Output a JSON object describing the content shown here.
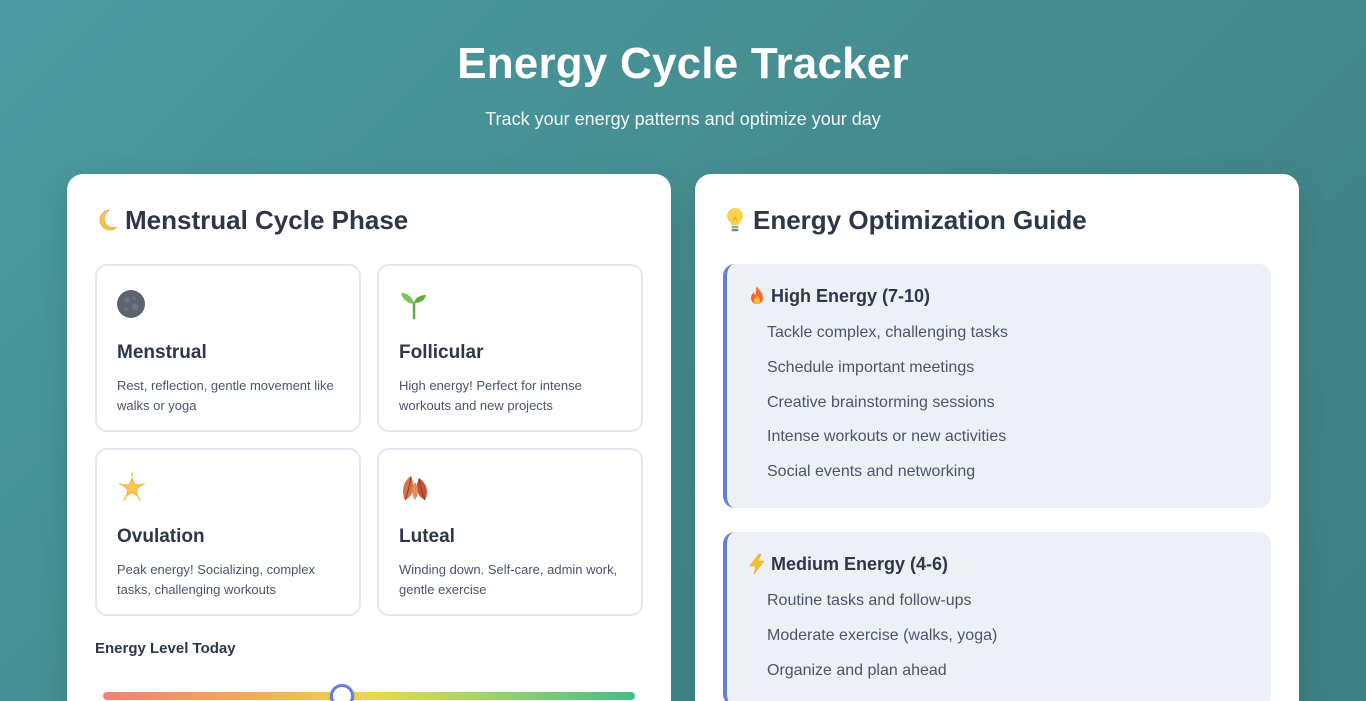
{
  "header": {
    "title": "Energy Cycle Tracker",
    "subtitle": "Track your energy patterns and optimize your day"
  },
  "cycle": {
    "title": "Menstrual Cycle Phase",
    "title_icon": "crescent-moon-icon",
    "phases": [
      {
        "name": "Menstrual",
        "icon": "new-moon-icon",
        "description": "Rest, reflection, gentle movement like walks or yoga"
      },
      {
        "name": "Follicular",
        "icon": "seedling-icon",
        "description": "High energy! Perfect for intense workouts and new projects"
      },
      {
        "name": "Ovulation",
        "icon": "glowing-star-icon",
        "description": "Peak energy! Socializing, complex tasks, challenging workouts"
      },
      {
        "name": "Luteal",
        "icon": "fallen-leaf-icon",
        "description": "Winding down. Self-care, admin work, gentle exercise"
      }
    ],
    "energy_label": "Energy Level Today",
    "energy_slider": {
      "fraction": 0.45
    }
  },
  "guide": {
    "title": "Energy Optimization Guide",
    "title_icon": "light-bulb-icon",
    "sections": [
      {
        "title": "High Energy (7-10)",
        "icon": "fire-icon",
        "items": [
          "Tackle complex, challenging tasks",
          "Schedule important meetings",
          "Creative brainstorming sessions",
          "Intense workouts or new activities",
          "Social events and networking"
        ]
      },
      {
        "title": "Medium Energy (4-6)",
        "icon": "lightning-icon",
        "items": [
          "Routine tasks and follow-ups",
          "Moderate exercise (walks, yoga)",
          "Organize and plan ahead"
        ]
      }
    ]
  },
  "colors": {
    "background": "#4a9ca0",
    "accent": "#6a7ed8",
    "card": "#ffffff",
    "guide_bg": "#edf1f6"
  }
}
